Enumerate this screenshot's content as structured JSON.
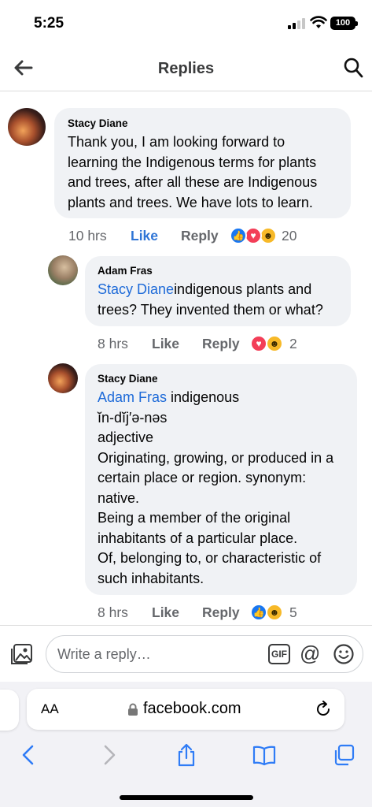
{
  "status_bar": {
    "time": "5:25",
    "battery": "100"
  },
  "header": {
    "title": "Replies",
    "back_icon": "arrow-left-icon",
    "search_icon": "search-icon"
  },
  "comments": [
    {
      "author": "Stacy Diane",
      "mention": "",
      "text": "Thank you, I am looking forward to learning the Indigenous terms for plants and trees, after all these are Indigenous plants and trees.  We have lots to learn.",
      "time": "10 hrs",
      "like_label": "Like",
      "like_active": true,
      "reply_label": "Reply",
      "reactions": [
        "like",
        "love",
        "haha"
      ],
      "reaction_count": "20"
    },
    {
      "author": "Adam Fras",
      "mention": "Stacy Diane",
      "text": "indigenous plants and trees? They invented them or what?",
      "time": "8 hrs",
      "like_label": "Like",
      "like_active": false,
      "reply_label": "Reply",
      "reactions": [
        "love",
        "haha"
      ],
      "reaction_count": "2"
    },
    {
      "author": "Stacy Diane",
      "mention": "Adam Fras",
      "text": "indigenous",
      "lines": [
        "ĭn-dĭj′ə-nəs",
        "adjective",
        "Originating, growing, or produced in a",
        "certain place or region. synonym:",
        "native.",
        "Being a member of the original",
        "inhabitants of a particular place.",
        "Of, belonging to, or characteristic of",
        "such inhabitants."
      ],
      "time": "8 hrs",
      "like_label": "Like",
      "like_active": false,
      "reply_label": "Reply",
      "reactions": [
        "like",
        "haha"
      ],
      "reaction_count": "5"
    }
  ],
  "composer": {
    "placeholder": "Write a reply…",
    "gif_label": "GIF",
    "at_label": "@"
  },
  "browser": {
    "aa_label": "AA",
    "domain": "facebook.com"
  },
  "colors": {
    "link": "#1d6ad8",
    "like_active": "#2f75d6",
    "bubble": "#f0f2f5"
  }
}
